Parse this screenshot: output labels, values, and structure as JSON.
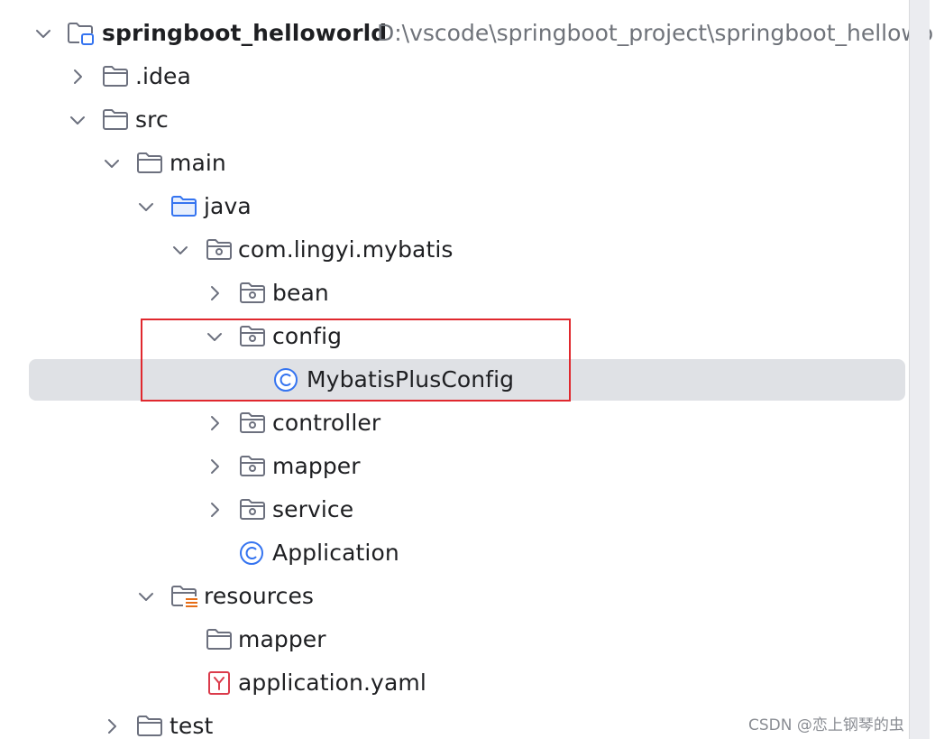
{
  "project": {
    "name": "springboot_helloworld",
    "path": "D:\\vscode\\springboot_project\\springboot_helloworld"
  },
  "tree": [
    {
      "label": "springboot_helloworld",
      "icon": "module-folder-icon",
      "chevron": "expanded"
    },
    {
      "label": ".idea",
      "icon": "folder-icon",
      "chevron": "collapsed"
    },
    {
      "label": "src",
      "icon": "folder-icon",
      "chevron": "expanded"
    },
    {
      "label": "main",
      "icon": "folder-icon",
      "chevron": "expanded"
    },
    {
      "label": "java",
      "icon": "source-folder-icon",
      "chevron": "expanded"
    },
    {
      "label": "com.lingyi.mybatis",
      "icon": "package-icon",
      "chevron": "expanded"
    },
    {
      "label": "bean",
      "icon": "package-icon",
      "chevron": "collapsed"
    },
    {
      "label": "config",
      "icon": "package-icon",
      "chevron": "expanded"
    },
    {
      "label": "MybatisPlusConfig",
      "icon": "class-icon",
      "chevron": "none",
      "selected": true
    },
    {
      "label": "controller",
      "icon": "package-icon",
      "chevron": "collapsed"
    },
    {
      "label": "mapper",
      "icon": "package-icon",
      "chevron": "collapsed"
    },
    {
      "label": "service",
      "icon": "package-icon",
      "chevron": "collapsed"
    },
    {
      "label": "Application",
      "icon": "class-icon",
      "chevron": "none"
    },
    {
      "label": "resources",
      "icon": "resources-folder-icon",
      "chevron": "expanded"
    },
    {
      "label": "mapper",
      "icon": "folder-icon",
      "chevron": "none"
    },
    {
      "label": "application.yaml",
      "icon": "yaml-file-icon",
      "chevron": "none"
    },
    {
      "label": "test",
      "icon": "folder-icon",
      "chevron": "collapsed"
    }
  ],
  "watermark": "CSDN @恋上钢琴的虫",
  "colors": {
    "selection": "#dfe1e5",
    "highlight_box": "#e0282e",
    "class_icon": "#3574f0",
    "source_folder": "#3574f0",
    "yaml_icon": "#db3b4b",
    "resources_marker": "#e66d17"
  }
}
